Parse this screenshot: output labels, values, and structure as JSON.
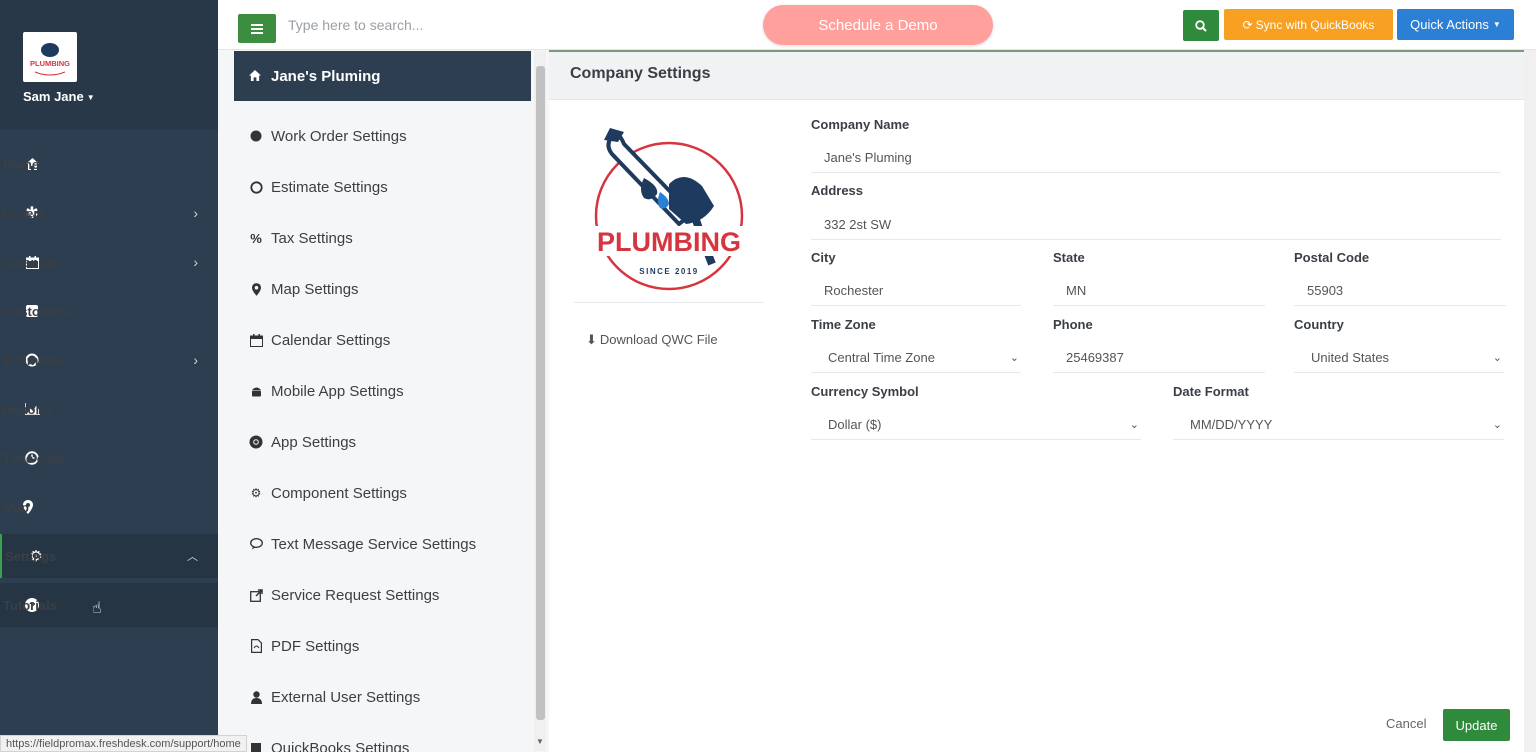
{
  "user": {
    "name": "Sam Jane",
    "logo_text": "PLUMBING"
  },
  "nav": {
    "items": [
      {
        "label": "Home",
        "icon": "home-icon"
      },
      {
        "label": "Orders",
        "icon": "asterisk-icon",
        "has_submenu": true
      },
      {
        "label": "Calendar",
        "icon": "calendar-icon",
        "has_submenu": true
      },
      {
        "label": "Customers",
        "icon": "square-icon"
      },
      {
        "label": "Estimates",
        "icon": "circle-outline-icon",
        "has_submenu": true
      },
      {
        "label": "Reports",
        "icon": "area-chart-icon"
      },
      {
        "label": "Time card",
        "icon": "clock-icon"
      },
      {
        "label": "Map",
        "icon": "map-marker-icon"
      },
      {
        "label": "Settings",
        "icon": "gear-icon",
        "expanded": true
      },
      {
        "label": "Tutorials",
        "icon": "question-circle-icon"
      }
    ]
  },
  "topbar": {
    "search_placeholder": "Type here to search...",
    "demo_label": "Schedule a Demo",
    "sync_label": "Sync with QuickBooks",
    "quick_actions_label": "Quick Actions"
  },
  "settings_menu": {
    "header": "Jane's Pluming",
    "items": [
      {
        "label": "Work Order Settings",
        "icon": "filled-circle-icon"
      },
      {
        "label": "Estimate Settings",
        "icon": "circle-outline-icon"
      },
      {
        "label": "Tax Settings",
        "icon": "percent-icon"
      },
      {
        "label": "Map Settings",
        "icon": "map-marker-icon"
      },
      {
        "label": "Calendar Settings",
        "icon": "calendar-icon"
      },
      {
        "label": "Mobile App Settings",
        "icon": "android-icon"
      },
      {
        "label": "App Settings",
        "icon": "chrome-icon"
      },
      {
        "label": "Component Settings",
        "icon": "cogs-icon"
      },
      {
        "label": "Text Message Service Settings",
        "icon": "comment-icon"
      },
      {
        "label": "Service Request Settings",
        "icon": "external-link-icon"
      },
      {
        "label": "PDF Settings",
        "icon": "file-pdf-icon"
      },
      {
        "label": "External User Settings",
        "icon": "user-icon"
      },
      {
        "label": "QuickBooks Settings",
        "icon": "book-icon"
      }
    ]
  },
  "company": {
    "title": "Company Settings",
    "logo": {
      "word": "PLUMBING",
      "since": "SINCE 2019"
    },
    "download_label": "Download QWC File",
    "fields": {
      "company_name": {
        "label": "Company Name",
        "value": "Jane's Pluming"
      },
      "address": {
        "label": "Address",
        "value": "332 2st SW"
      },
      "city": {
        "label": "City",
        "value": "Rochester"
      },
      "state": {
        "label": "State",
        "value": "MN"
      },
      "postal_code": {
        "label": "Postal Code",
        "value": "55903"
      },
      "time_zone": {
        "label": "Time Zone",
        "value": "Central Time Zone"
      },
      "phone": {
        "label": "Phone",
        "value": "25469387"
      },
      "country": {
        "label": "Country",
        "value": "United States"
      },
      "currency": {
        "label": "Currency Symbol",
        "value": "Dollar ($)"
      },
      "date_format": {
        "label": "Date Format",
        "value": "MM/DD/YYYY"
      }
    },
    "cancel_label": "Cancel",
    "update_label": "Update"
  },
  "status_bar": {
    "url": "https://fieldpromax.freshdesk.com/support/home"
  },
  "colors": {
    "sidebar": "#2d3e50",
    "green": "#3c8d3f",
    "demo": "#ffa09c",
    "sync": "#f7a022",
    "quick": "#2b7fd4",
    "logo_red": "#d6343f",
    "logo_navy": "#1f3a5f"
  }
}
